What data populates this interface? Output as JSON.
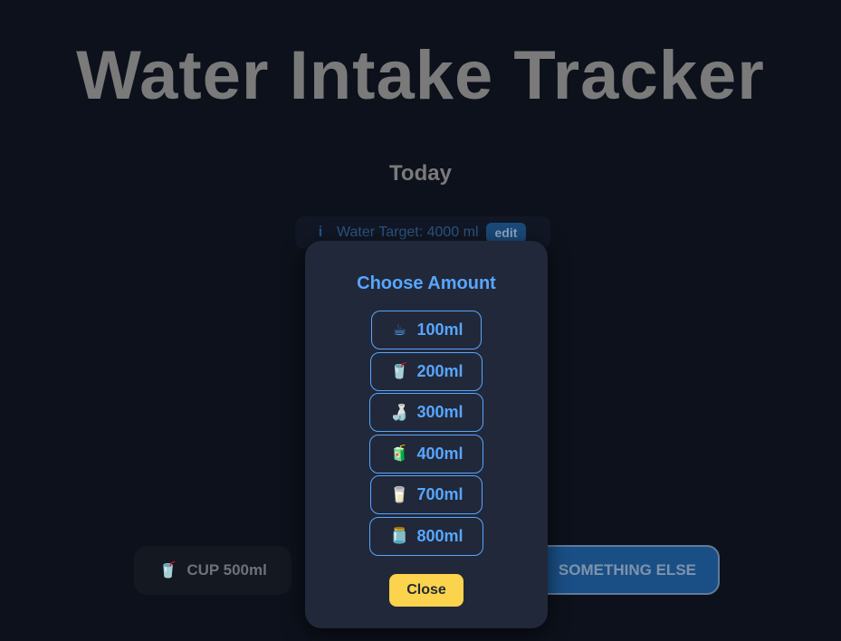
{
  "app_title": "Water Intake Tracker",
  "day_label": "Today",
  "target": {
    "info_icon": "i",
    "text": "Water Target: 4000 ml",
    "edit_label": "edit"
  },
  "quick_buttons": {
    "cup": {
      "icon": "🥤",
      "label": "CUP 500ml"
    },
    "something_else": {
      "label": "SOMETHING ELSE"
    }
  },
  "modal": {
    "title": "Choose Amount",
    "amounts": [
      {
        "icon": "☕",
        "label": "100ml",
        "icon_name": "coffee-cup-icon"
      },
      {
        "icon": "🥤",
        "label": "200ml",
        "icon_name": "cup-with-straw-icon"
      },
      {
        "icon": "🍶",
        "label": "300ml",
        "icon_name": "bottle-icon"
      },
      {
        "icon": "🧃",
        "label": "400ml",
        "icon_name": "juice-box-icon"
      },
      {
        "icon": "🥛",
        "label": "700ml",
        "icon_name": "milk-glass-icon"
      },
      {
        "icon": "🫙",
        "label": "800ml",
        "icon_name": "jar-icon"
      }
    ],
    "close_label": "Close"
  },
  "colors": {
    "background": "#0c111b",
    "modal_bg": "#212839",
    "accent": "#58a6ff",
    "close_button": "#fcd34d"
  }
}
